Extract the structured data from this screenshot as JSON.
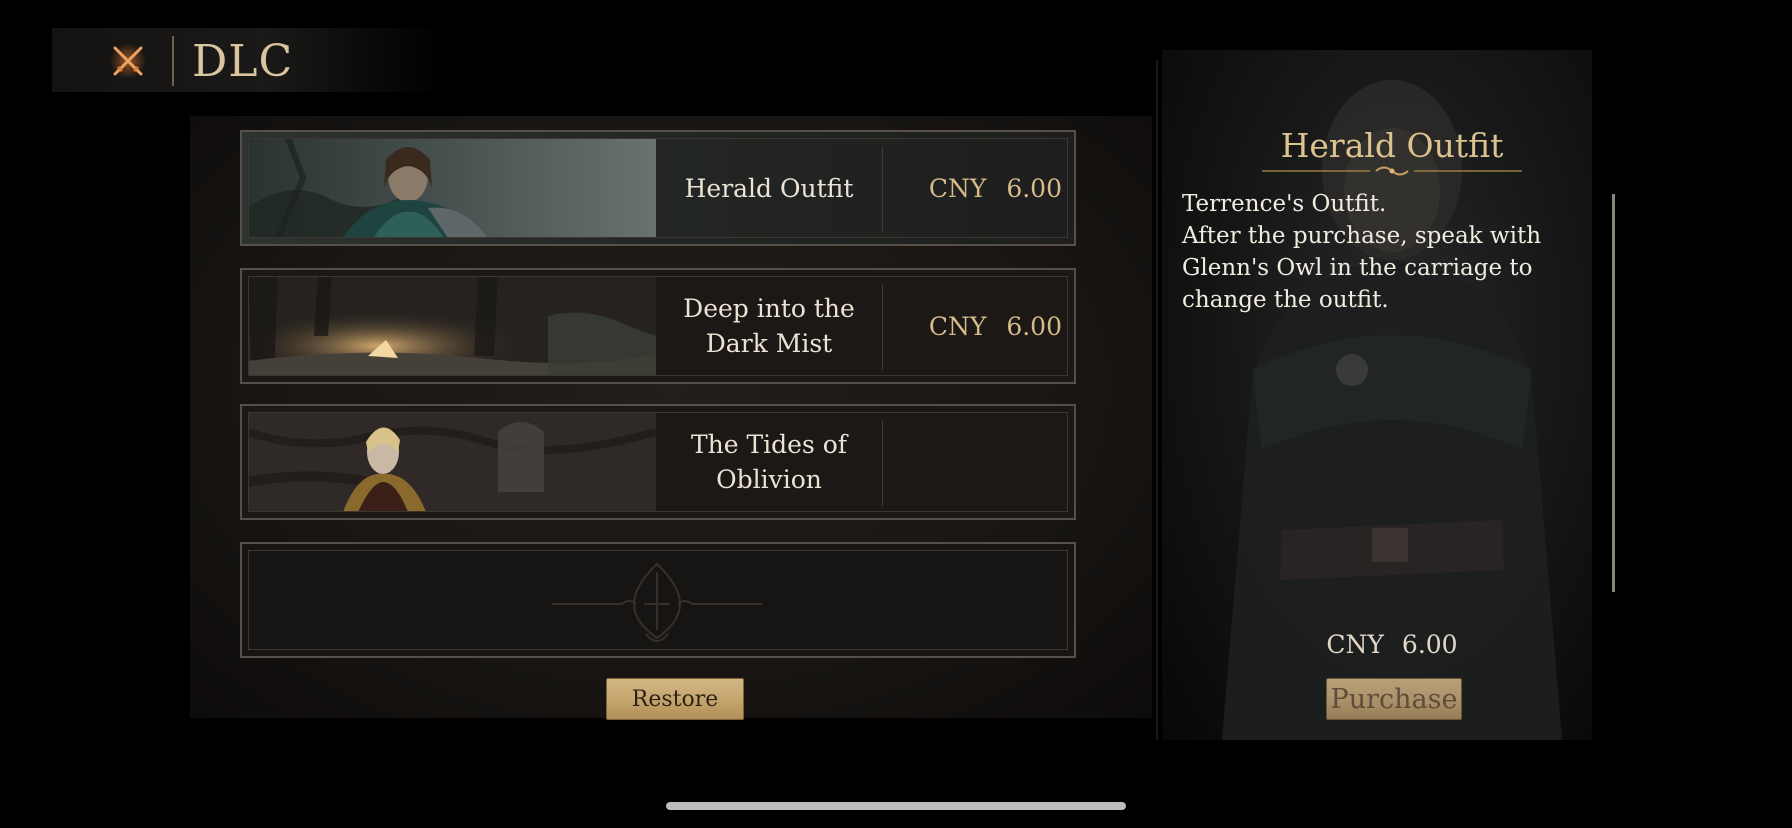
{
  "header": {
    "title": "DLC"
  },
  "dlc_items": [
    {
      "name": "Herald Outfit",
      "currency": "CNY",
      "price": "6.00"
    },
    {
      "name": "Deep into the Dark Mist",
      "currency": "CNY",
      "price": "6.00"
    },
    {
      "name": "The Tides of Oblivion"
    }
  ],
  "restore_label": "Restore",
  "detail": {
    "title": "Herald Outfit",
    "description": [
      "Terrence's Outfit.",
      "After the purchase, speak with Glenn's Owl in the carriage to change the outfit."
    ],
    "currency": "CNY",
    "price": "6.00",
    "purchase_label": "Purchase"
  },
  "colors": {
    "gold": "#d9c6a0",
    "price": "#d7b98a",
    "accent_close": "#e07a3a"
  },
  "icons": {
    "close": "crossed-swords-icon",
    "emblem": "emblem-icon",
    "ornament": "title-ornament"
  }
}
